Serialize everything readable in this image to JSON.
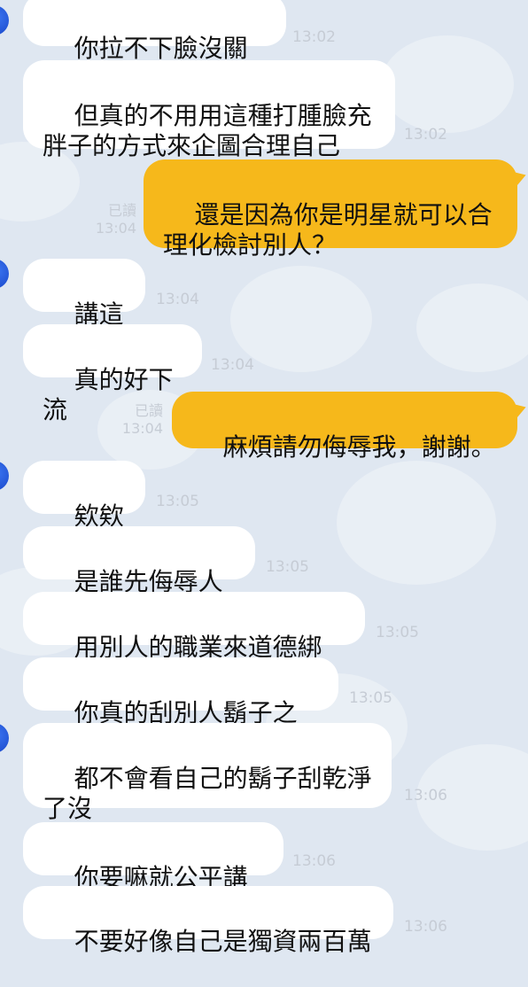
{
  "colors": {
    "background": "#dfe7f1",
    "incoming_bubble": "#ffffff",
    "outgoing_bubble": "#f6b81b",
    "avatar": "#1f4fd1",
    "timestamp": "#c6ccd5"
  },
  "chat": {
    "messages": [
      {
        "sender": "other",
        "text": "你拉不下臉沒關係",
        "time": "13:02"
      },
      {
        "sender": "other",
        "text": "但真的不用用這種打腫臉充\n胖子的方式來企圖合理自己",
        "time": "13:02"
      },
      {
        "sender": "me",
        "text": "還是因為你是明星就可以合\n理化檢討別人？",
        "read": "已讀",
        "time": "13:04"
      },
      {
        "sender": "other",
        "text": "講這話",
        "time": "13:04"
      },
      {
        "sender": "other",
        "text": "真的好下流",
        "time": "13:04"
      },
      {
        "sender": "me",
        "text": "麻煩請勿侮辱我，謝謝。",
        "read": "已讀",
        "time": "13:04"
      },
      {
        "sender": "other",
        "text": "欸欸欸",
        "time": "13:05"
      },
      {
        "sender": "other",
        "text": "是誰先侮辱人啊",
        "time": "13:05"
      },
      {
        "sender": "other",
        "text": "用別人的職業來道德綁架",
        "time": "13:05"
      },
      {
        "sender": "other",
        "text": "你真的刮別人鬍子之前",
        "time": "13:05"
      },
      {
        "sender": "other",
        "text": "都不會看自己的鬍子刮乾淨\n了沒",
        "time": "13:06"
      },
      {
        "sender": "other",
        "text": "你要嘛就公平講話",
        "time": "13:06"
      },
      {
        "sender": "other",
        "text": "不要好像自己是獨資兩百萬",
        "time": "13:06"
      }
    ]
  }
}
